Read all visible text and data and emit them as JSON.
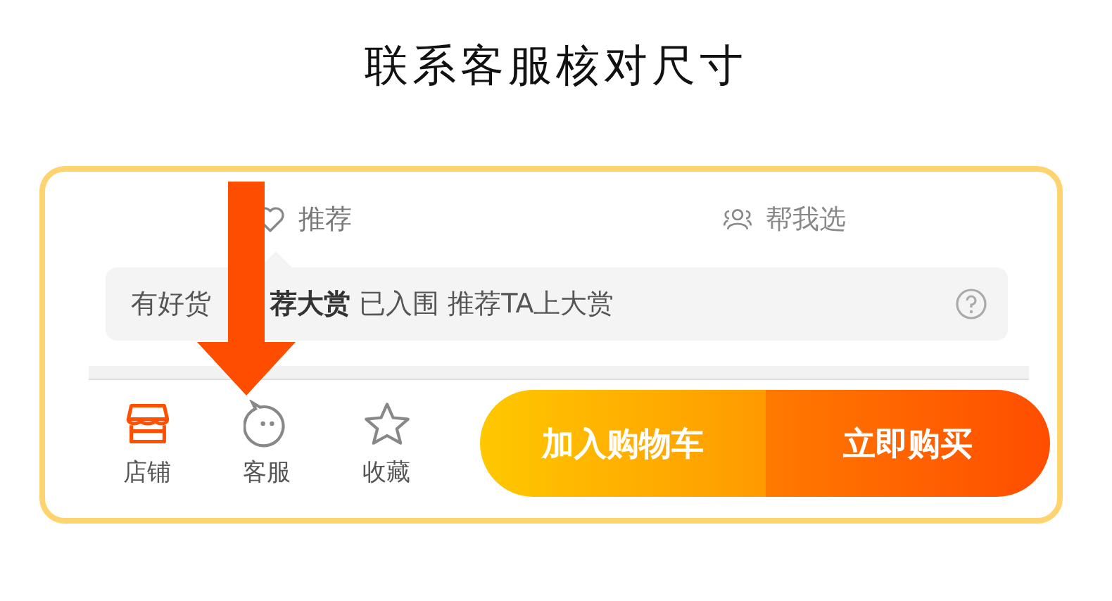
{
  "title": "联系客服核对尺寸",
  "tabs": [
    {
      "label": "推荐",
      "selected": true
    },
    {
      "label": "帮我选",
      "selected": false
    }
  ],
  "banner": {
    "parts": [
      "有好货",
      "**荐大赏** 已入围 推荐TA上大赏"
    ]
  },
  "nav": [
    {
      "label": "店铺",
      "selected": true
    },
    {
      "label": "客服",
      "selected": false
    },
    {
      "label": "收藏",
      "selected": false
    }
  ],
  "buttons": [
    {
      "label": "加入购物车",
      "kind": "cart"
    },
    {
      "label": "立即购买",
      "kind": "buy"
    }
  ]
}
